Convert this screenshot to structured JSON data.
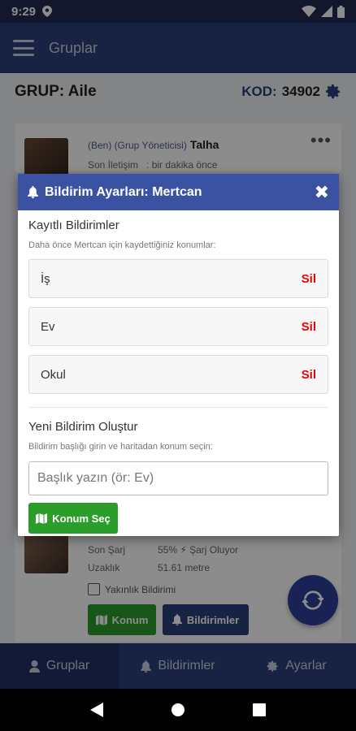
{
  "status": {
    "time": "9:29"
  },
  "appbar": {
    "title": "Gruplar"
  },
  "group": {
    "title": "GRUP: Aile",
    "code_label": "KOD:",
    "code_value": "34902"
  },
  "member1": {
    "role": "(Ben) (Grup Yöneticisi)",
    "name": "Talha",
    "last_seen_label": "Son İletişim",
    "last_seen_value": ": bir dakika önce"
  },
  "member2": {
    "charge_label": "Son Şarj",
    "charge_value": "55% ⚡ Şarj Oluyor",
    "distance_label": "Uzaklık",
    "distance_value": "51.61 metre",
    "proximity_label": "Yakınlık Bildirimi",
    "location_button": "Konum",
    "notifications_button": "Bildirimler"
  },
  "modal": {
    "title": "Bildirim Ayarları: Mertcan",
    "saved_title": "Kayıtlı Bildirimler",
    "saved_subtitle": "Daha önce Mertcan için kaydettiğiniz konumlar:",
    "locations": [
      {
        "name": "İş",
        "delete": "Sil"
      },
      {
        "name": "Ev",
        "delete": "Sil"
      },
      {
        "name": "Okul",
        "delete": "Sil"
      }
    ],
    "new_title": "Yeni Bildirim Oluştur",
    "new_subtitle": "Bildirim başlığı girin ve haritadan konum seçin:",
    "input_placeholder": "Başlık yazın (ör: Ev)",
    "select_button": "Konum Seç"
  },
  "bottomnav": {
    "groups": "Gruplar",
    "notifications": "Bildirimler",
    "settings": "Ayarlar"
  },
  "colors": {
    "primary": "#2c3f7a",
    "modal_header": "#3b52a3",
    "green": "#2a9d2a",
    "delete": "#e00000"
  }
}
